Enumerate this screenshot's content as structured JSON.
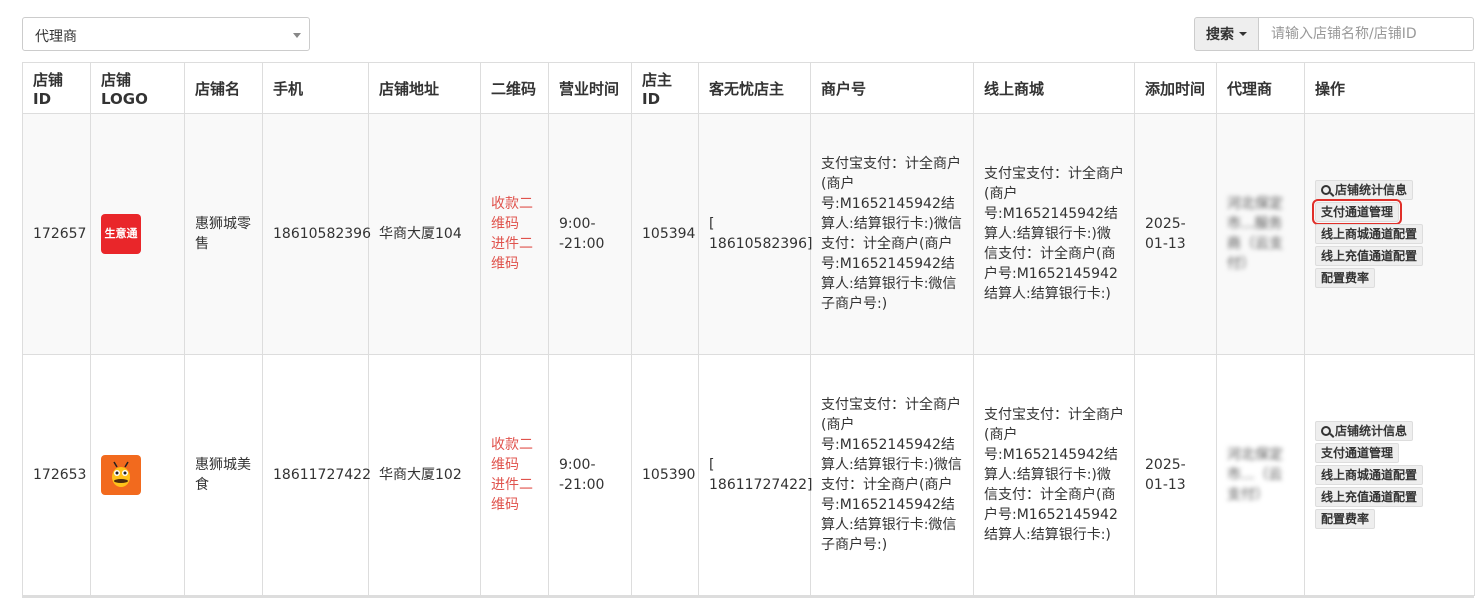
{
  "filter": {
    "agent_select": "代理商"
  },
  "search": {
    "button_label": "搜索",
    "placeholder": "请输入店铺名称/店铺ID"
  },
  "table": {
    "headers": [
      "店铺ID",
      "店铺LOGO",
      "店铺名",
      "手机",
      "店铺地址",
      "二维码",
      "营业时间",
      "店主ID",
      "客无忧店主",
      "商户号",
      "线上商城",
      "添加时间",
      "代理商",
      "操作"
    ],
    "rows": [
      {
        "shop_id": "172657",
        "logo_text": "生意通",
        "logo_icon": "shengyitong-logo",
        "name": "惠狮城零售",
        "phone": "18610582396",
        "address": "华商大厦104",
        "qrcode_links": [
          "收款二维码",
          "进件二维码"
        ],
        "hours": "9:00--21:00",
        "owner_id": "105394",
        "kwy_owner": "[ 18610582396]",
        "merchant_no": "支付宝支付：计全商户(商户号:M1652145942结算人:结算银行卡:)微信支付：计全商户(商户号:M1652145942结算人:结算银行卡:微信子商户号:)",
        "online_mall": "支付宝支付：计全商户(商户号:M1652145942结算人:结算银行卡:)微信支付：计全商户(商户号:M1652145942结算人:结算银行卡:)",
        "added": "2025-01-13",
        "agent": "河北保定市...服务商（云支付）"
      },
      {
        "shop_id": "172653",
        "logo_icon": "bee-mascot-logo",
        "name": "惠狮城美食",
        "phone": "18611727422",
        "address": "华商大厦102",
        "qrcode_links": [
          "收款二维码",
          "进件二维码"
        ],
        "hours": "9:00--21:00",
        "owner_id": "105390",
        "kwy_owner": "[ 18611727422]",
        "merchant_no": "支付宝支付：计全商户(商户号:M1652145942结算人:结算银行卡:)微信支付：计全商户(商户号:M1652145942结算人:结算银行卡:微信子商户号:)",
        "online_mall": "支付宝支付：计全商户(商户号:M1652145942结算人:结算银行卡:)微信支付：计全商户(商户号:M1652145942结算人:结算银行卡:)",
        "added": "2025-01-13",
        "agent": "河北保定市...（云支付）"
      }
    ],
    "actions": [
      "店铺统计信息",
      "支付通道管理",
      "线上商城通道配置",
      "线上充值通道配置",
      "配置费率"
    ]
  },
  "colors": {
    "link_red": "#e0534d",
    "highlight_red": "#e0302a",
    "logo_red": "#e9262a",
    "logo_orange": "#f26a1e"
  }
}
